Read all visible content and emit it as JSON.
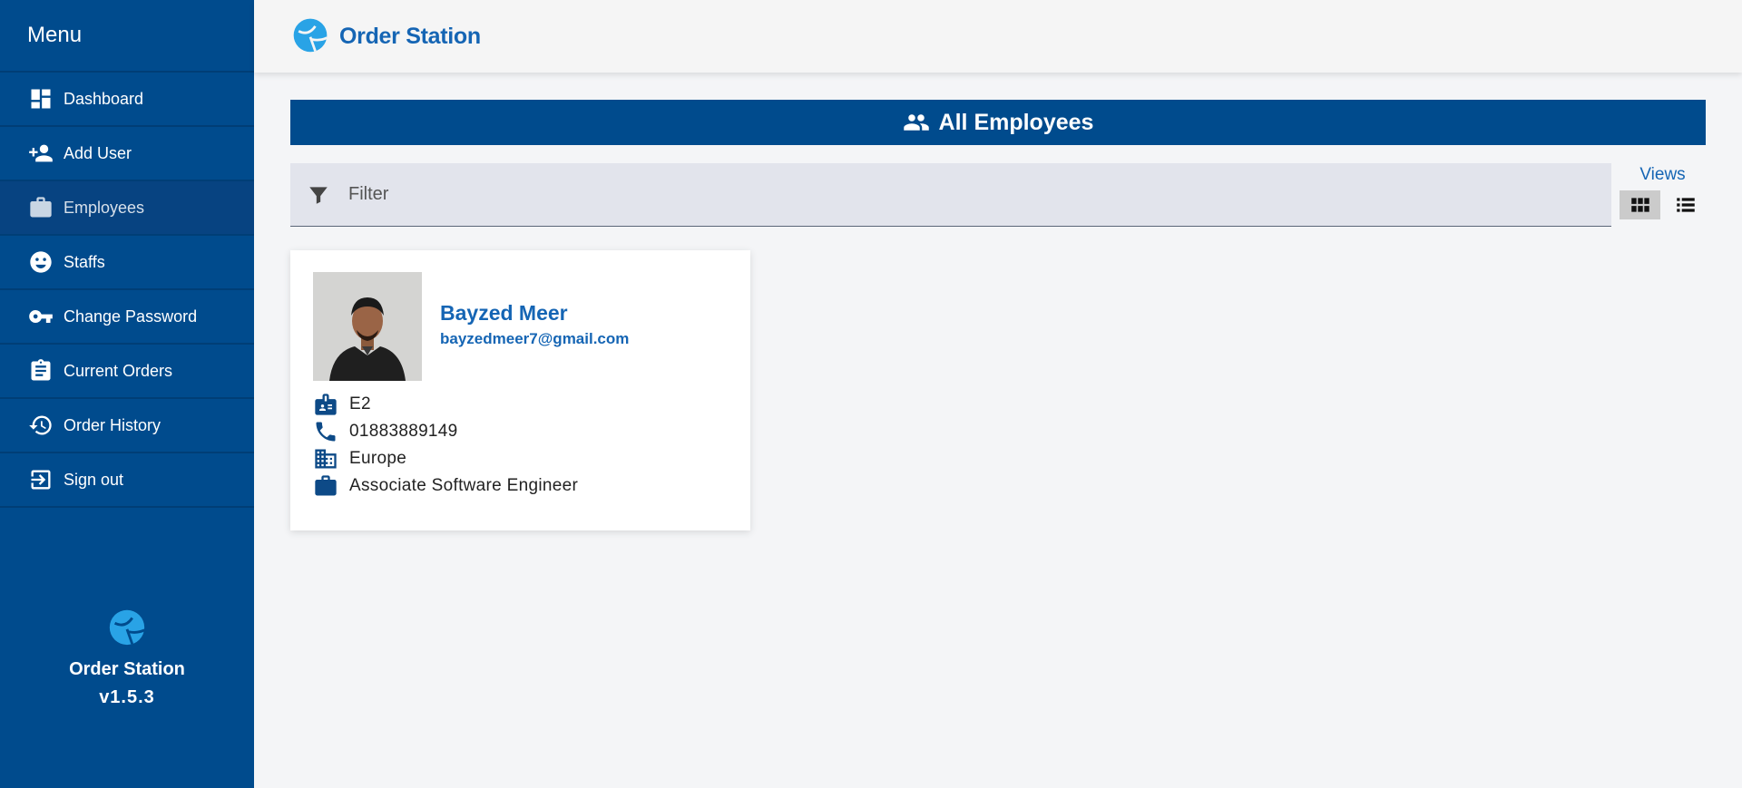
{
  "sidebar": {
    "title": "Menu",
    "items": [
      {
        "label": "Dashboard",
        "icon": "dashboard-icon"
      },
      {
        "label": "Add User",
        "icon": "add-user-icon"
      },
      {
        "label": "Employees",
        "icon": "briefcase-icon",
        "active": true
      },
      {
        "label": "Staffs",
        "icon": "face-icon"
      },
      {
        "label": "Change Password",
        "icon": "key-icon"
      },
      {
        "label": "Current Orders",
        "icon": "clipboard-icon"
      },
      {
        "label": "Order History",
        "icon": "history-icon"
      },
      {
        "label": "Sign out",
        "icon": "sign-out-icon"
      }
    ],
    "footer": {
      "name": "Order Station",
      "version": "v1.5.3"
    }
  },
  "header": {
    "brand": "Order Station"
  },
  "main": {
    "title": "All Employees",
    "filter": {
      "placeholder": "Filter",
      "value": ""
    },
    "views": {
      "label": "Views",
      "selected": "grid"
    },
    "employees": [
      {
        "name": "Bayzed Meer",
        "email": "bayzedmeer7@gmail.com",
        "id": "E2",
        "phone": "01883889149",
        "region": "Europe",
        "designation": "Associate Software Engineer"
      }
    ]
  },
  "colors": {
    "primary": "#004b8d",
    "accent": "#1565b4",
    "logo": "#29a3e6",
    "background": "#f4f5f7"
  }
}
